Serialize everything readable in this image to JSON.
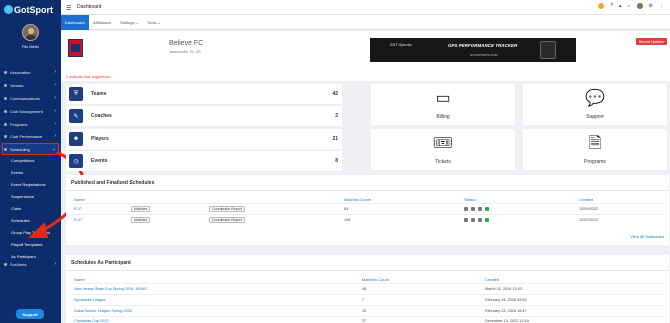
{
  "app": {
    "logo_text": "GotSport",
    "page_title": "Dashboard"
  },
  "user": {
    "name": "Rio Mello"
  },
  "sidebar": {
    "items": [
      {
        "label": "Association"
      },
      {
        "label": "Venues"
      },
      {
        "label": "Communications"
      },
      {
        "label": "Club Management"
      },
      {
        "label": "Programs"
      },
      {
        "label": "Club Performance"
      },
      {
        "label": "Scheduling"
      }
    ],
    "scheduling_sub": [
      {
        "label": "Competitions"
      },
      {
        "label": "Events"
      },
      {
        "label": "Event Registrations"
      },
      {
        "label": "Suspensions"
      },
      {
        "label": "Clubs"
      },
      {
        "label": "Schedules"
      },
      {
        "label": "Group Play Templates"
      },
      {
        "label": "Playoff Templates"
      },
      {
        "label": "As Participant"
      }
    ],
    "bottom_item": {
      "label": "SurAlerts"
    },
    "support_label": "Support"
  },
  "tabs": [
    {
      "label": "Dashboard"
    },
    {
      "label": "Affiliations"
    },
    {
      "label": "Settings ⌄"
    },
    {
      "label": "Tools ⌄"
    }
  ],
  "club": {
    "name": "Believe FC",
    "location": "Jacksonville, FL, US",
    "duplicate_notice": "1 duplicate user suggestions ›",
    "recent_updates": "Recent Updates"
  },
  "banner": {
    "brand": "SST Sports",
    "headline": "GPS PERFORMANCE TRACKER",
    "url": "STATSPORTS.COM"
  },
  "stats": [
    {
      "label": "Teams",
      "value": "42",
      "icon": "shield-icon"
    },
    {
      "label": "Coaches",
      "value": "2",
      "icon": "coach-icon"
    },
    {
      "label": "Players",
      "value": "21",
      "icon": "players-icon"
    },
    {
      "label": "Events",
      "value": "8",
      "icon": "clock-icon"
    }
  ],
  "tiles": [
    {
      "label": "Billing",
      "icon": "billing-icon"
    },
    {
      "label": "Support",
      "icon": "chat-icon"
    },
    {
      "label": "Tickets",
      "icon": "ticket-icon"
    },
    {
      "label": "Programs",
      "icon": "document-icon"
    }
  ],
  "published": {
    "title": "Published and Finalized Schedules",
    "headers": {
      "name": "Name",
      "matches": "Matches Count",
      "status": "Status",
      "created": "Created"
    },
    "rows": [
      {
        "name": "R-17",
        "matches_btn": "Matches",
        "report_btn": "Coordinator Report",
        "matches_count": "63",
        "created": "12/09/2022"
      },
      {
        "name": "R-17",
        "matches_btn": "Matches",
        "report_btn": "Coordinator Report",
        "matches_count": "106",
        "created": "12/07/2022"
      }
    ],
    "view_all": "View All Schedules"
  },
  "participant": {
    "title": "Schedules As Participant",
    "headers": {
      "name": "Name",
      "matches": "Matches Count",
      "created": "Created"
    },
    "rows": [
      {
        "name": "New Jersey State Cup Spring 2026- DEMO",
        "matches_count": "48",
        "created": "March 02, 2026 13:03"
      },
      {
        "name": "Sportswire League",
        "matches_count": "7",
        "created": "February 24, 2026 09:54"
      },
      {
        "name": "Dukal Soccer League Spring 2026",
        "matches_count": "15",
        "created": "February 03, 2026 16:47"
      },
      {
        "name": "Christmas Cup 2022",
        "matches_count": "27",
        "created": "December 13, 2022 12:19"
      }
    ]
  }
}
